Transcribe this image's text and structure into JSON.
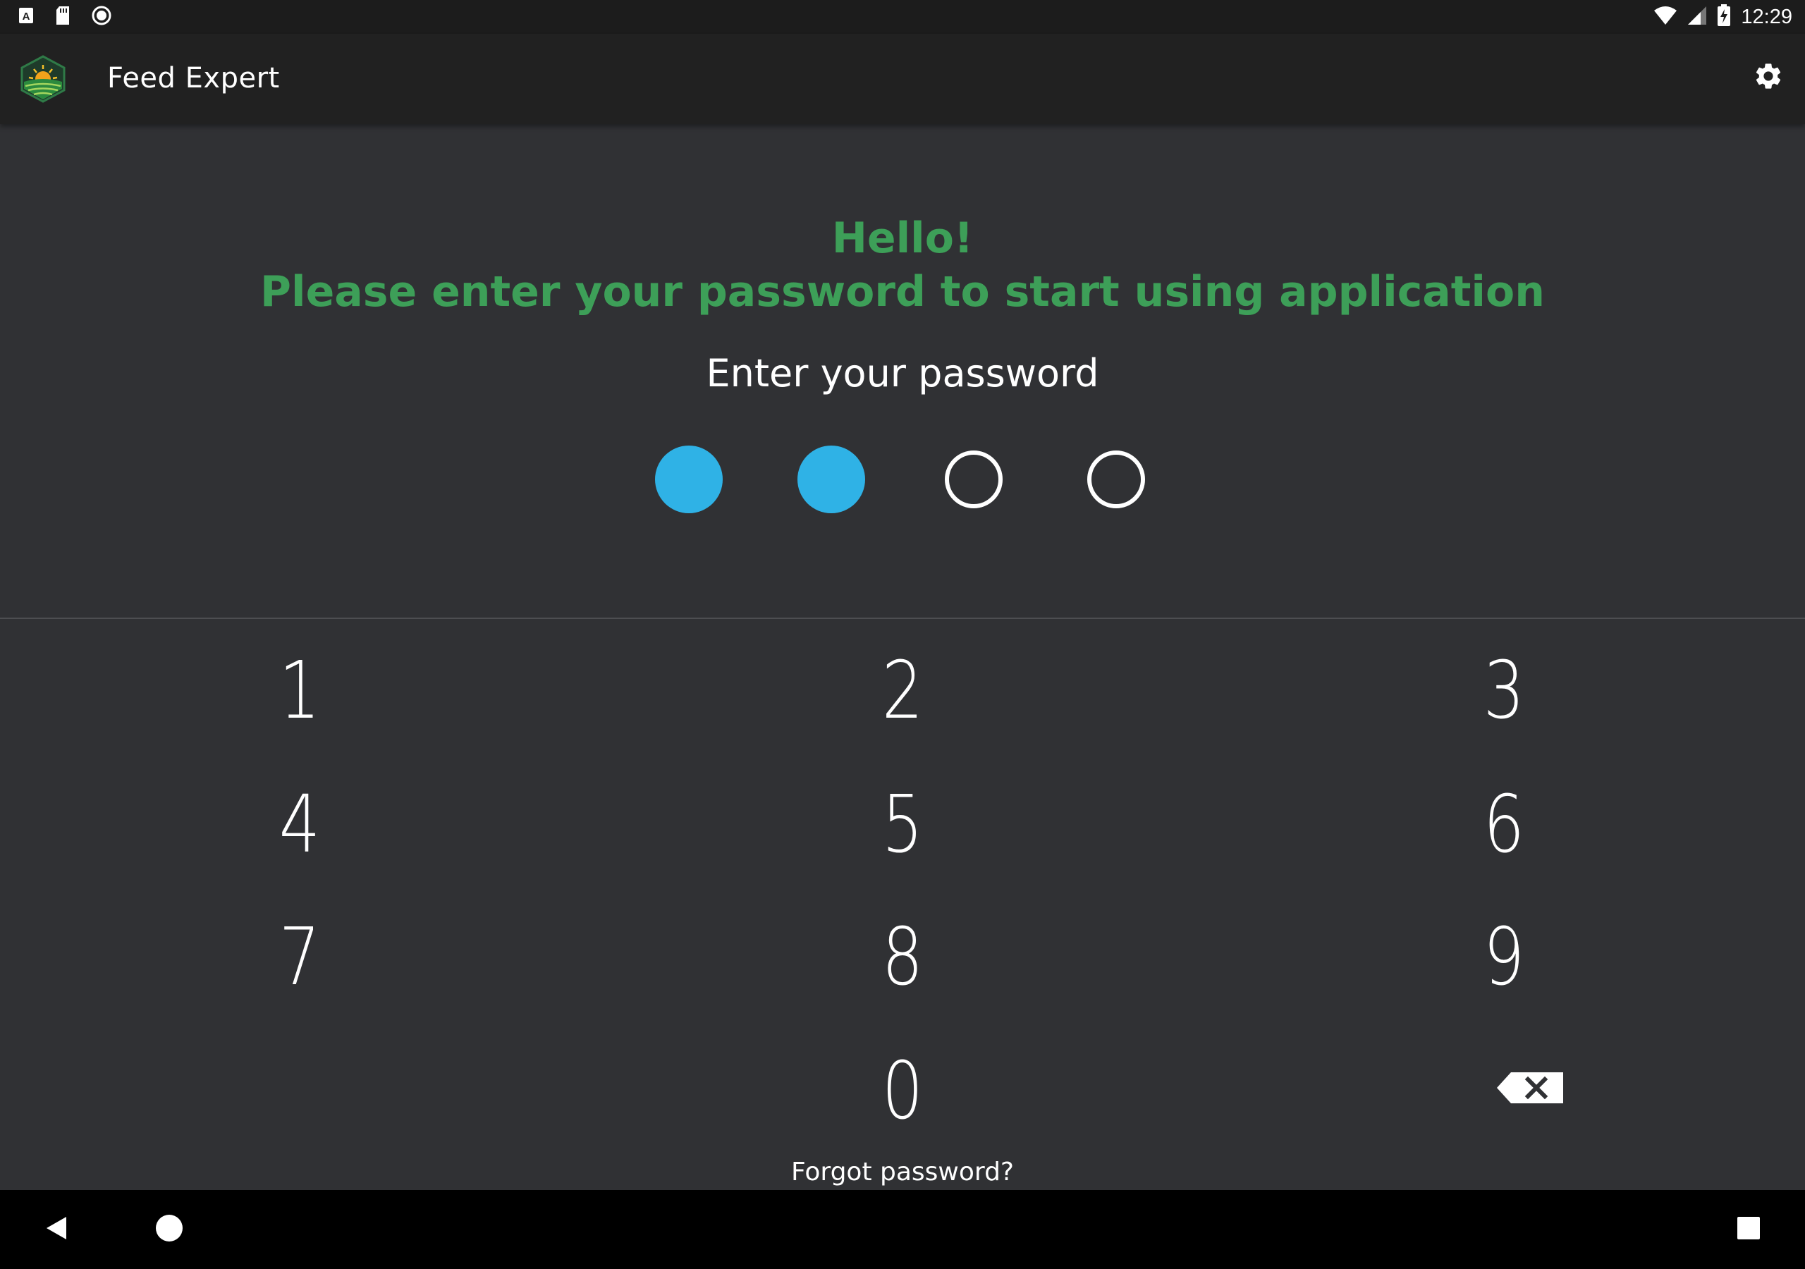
{
  "status_bar": {
    "time": "12:29",
    "left_icons": [
      "notification-a-icon",
      "sd-card-icon",
      "record-icon"
    ],
    "right_icons": [
      "wifi-icon",
      "cell-signal-icon",
      "battery-charging-icon"
    ]
  },
  "app_bar": {
    "title": "Feed Expert",
    "logo_icon": "feed-expert-logo-icon",
    "settings_icon": "gear-icon"
  },
  "greeting": {
    "line1": "Hello!",
    "line2": "Please enter your password to start using application"
  },
  "prompt": "Enter your password",
  "pin": {
    "length": 4,
    "entered": 2,
    "filled_color": "#2fb2e6"
  },
  "keypad": {
    "keys": [
      "1",
      "2",
      "3",
      "4",
      "5",
      "6",
      "7",
      "8",
      "9",
      "0"
    ],
    "backspace_icon": "backspace-icon"
  },
  "forgot_password": "Forgot password?",
  "nav_bar": {
    "icons": [
      "back-icon",
      "home-icon",
      "recents-icon"
    ]
  },
  "colors": {
    "accent_green": "#3d9f58",
    "pin_blue": "#2fb2e6",
    "background": "#303134",
    "app_bar": "#212121"
  }
}
